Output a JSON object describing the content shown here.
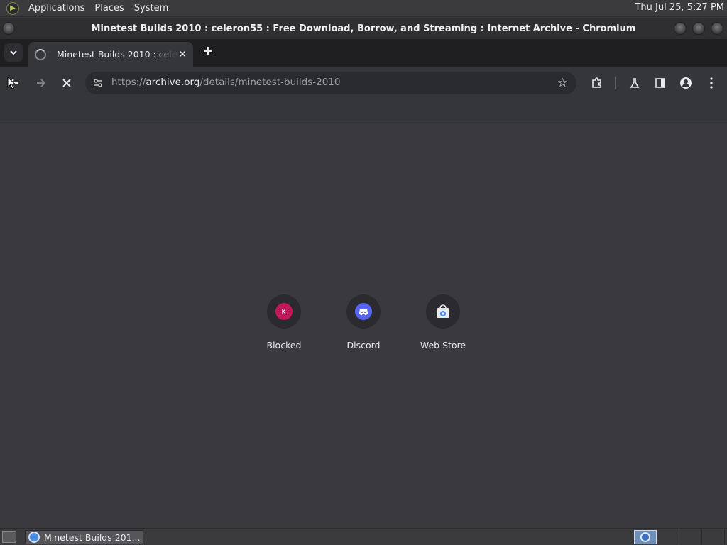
{
  "top_panel": {
    "menus": [
      "Applications",
      "Places",
      "System"
    ],
    "clock": "Thu Jul 25,  5:27 PM"
  },
  "window": {
    "title": "Minetest Builds 2010 : celeron55 : Free Download, Borrow, and Streaming : Internet Archive - Chromium"
  },
  "tabs": [
    {
      "title": "Minetest Builds 2010 : celeron55 : Free Download, Borrow, and Streaming : Internet Archive",
      "close_glyph": "✕"
    }
  ],
  "toolbar": {
    "url_prefix": "https://",
    "url_host": "archive.org",
    "url_path": "/details/minetest-builds-2010"
  },
  "shortcuts": [
    {
      "label": "Blocked",
      "icon": "k-letter-icon",
      "icon_text": "K"
    },
    {
      "label": "Discord",
      "icon": "discord-icon"
    },
    {
      "label": "Web Store",
      "icon": "web-store-icon"
    }
  ],
  "taskbar": {
    "window_button_label": "Minetest Builds 201..."
  }
}
